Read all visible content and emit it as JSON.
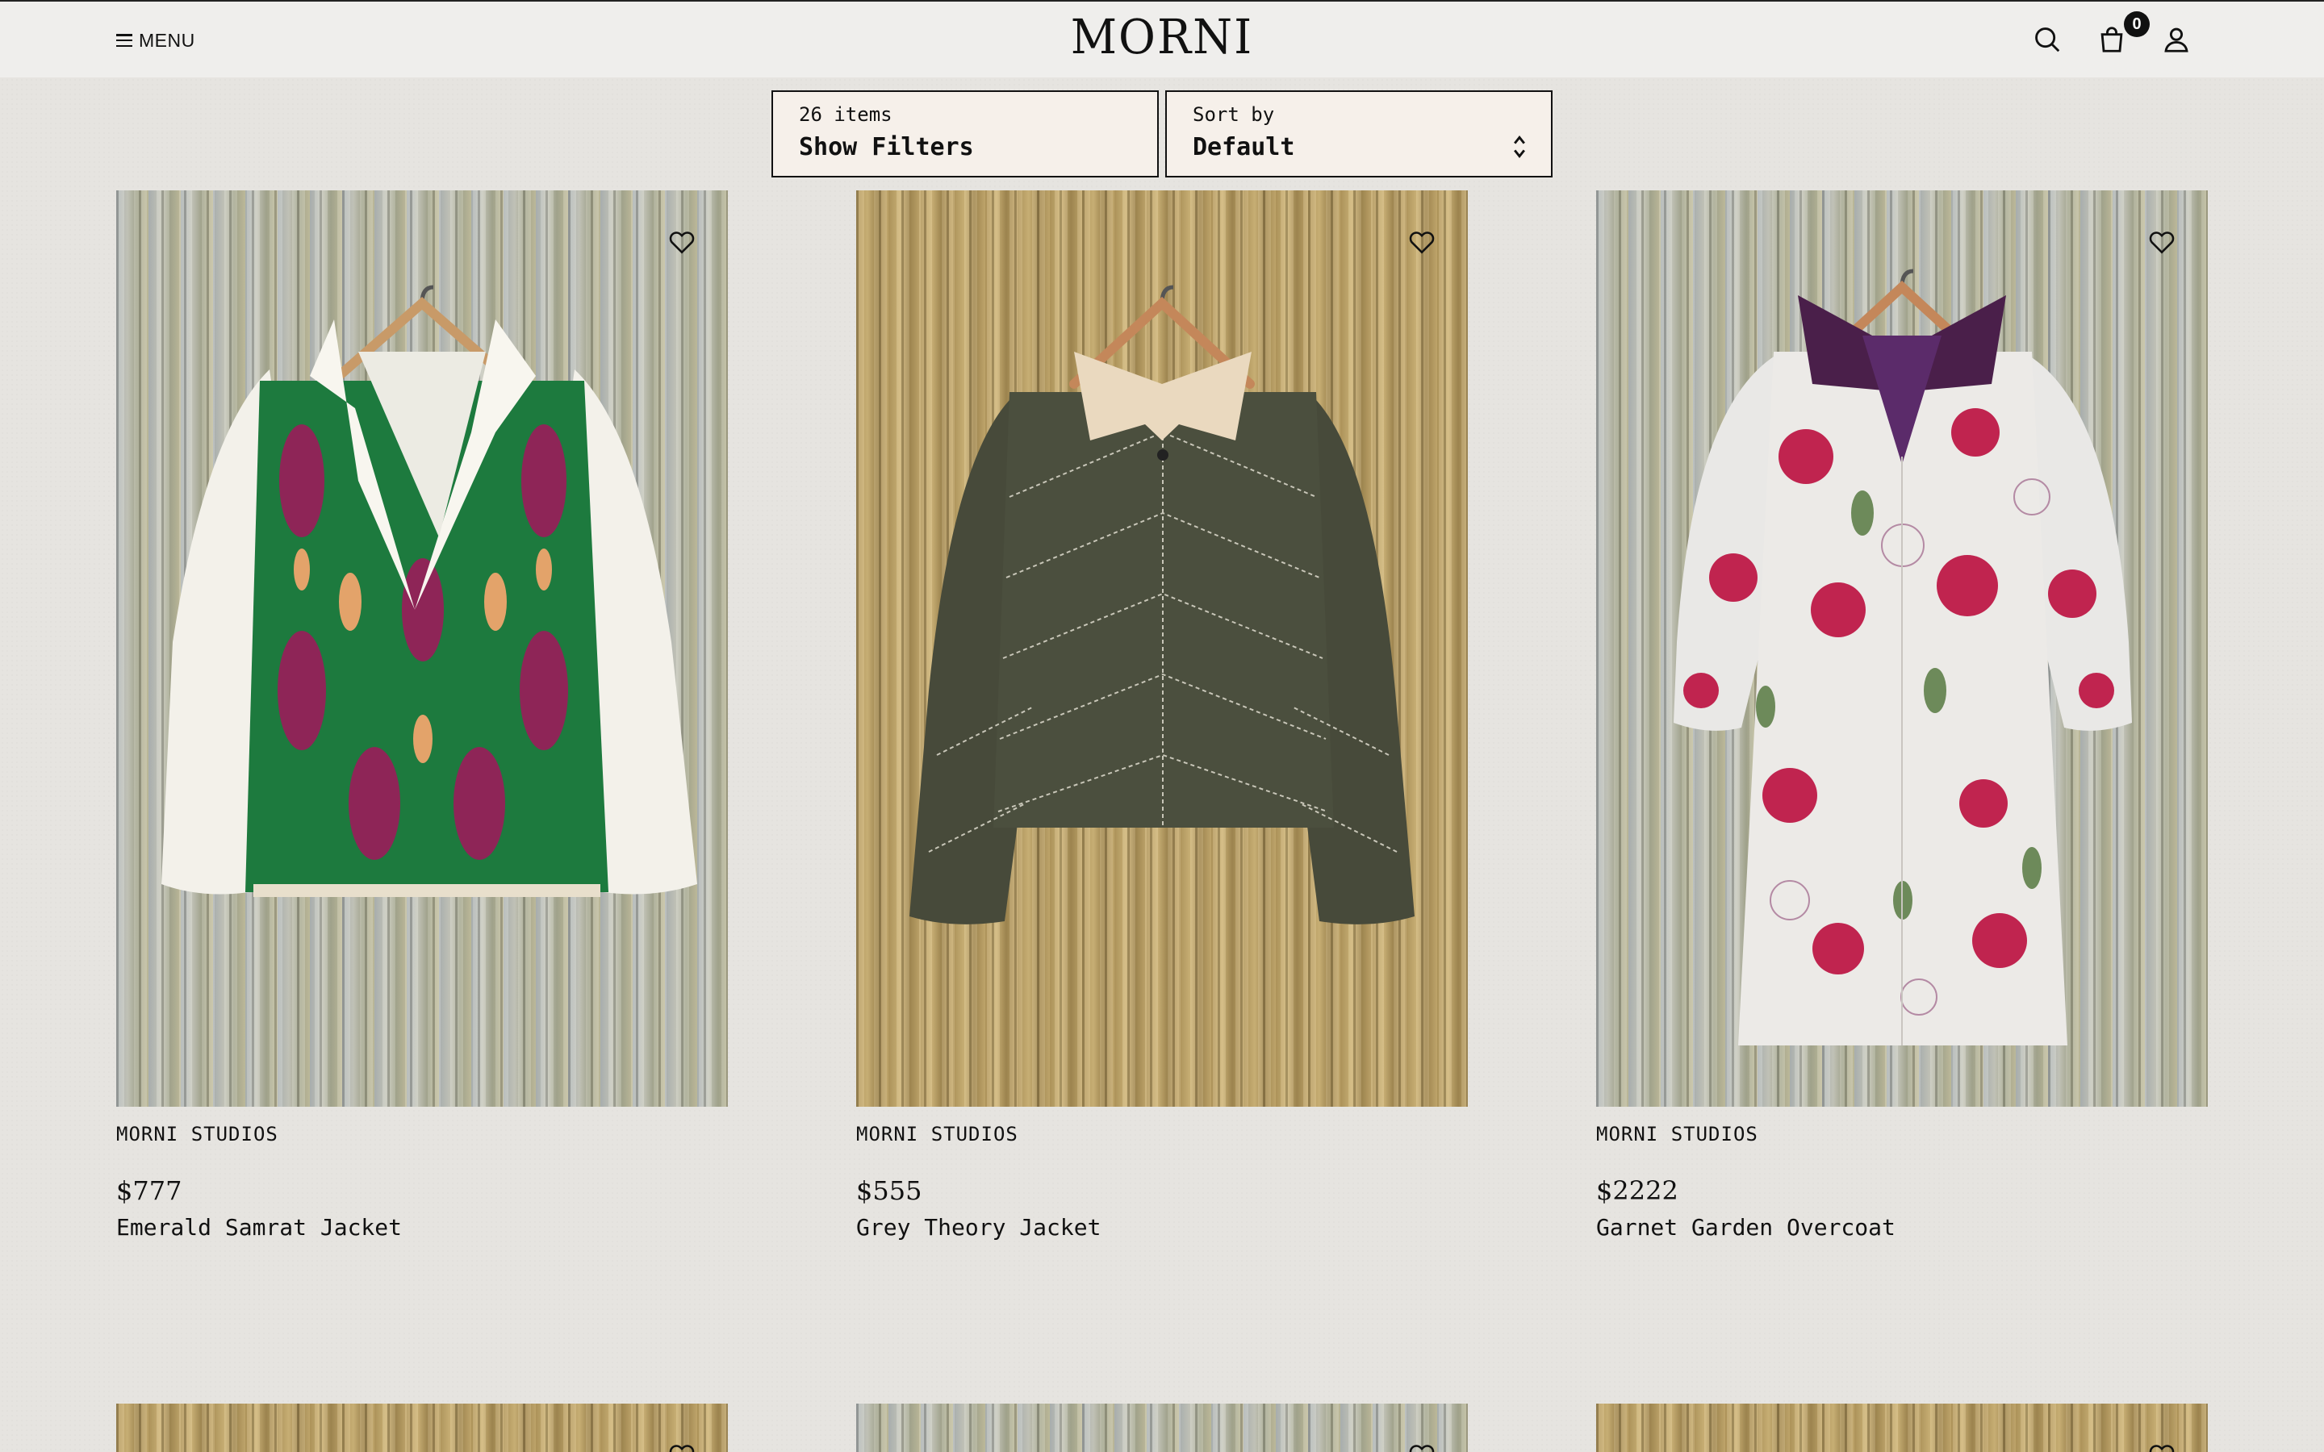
{
  "header": {
    "menu_label": "MENU",
    "logo": "MORNI",
    "cart_count": "0"
  },
  "toolbar": {
    "item_count": "26 items",
    "filter_label": "Show Filters",
    "sort_caption": "Sort by",
    "sort_value": "Default"
  },
  "products": [
    {
      "brand": "MORNI STUDIOS",
      "price": "$777",
      "name": "Emerald Samrat Jacket"
    },
    {
      "brand": "MORNI STUDIOS",
      "price": "$555",
      "name": "Grey Theory Jacket"
    },
    {
      "brand": "MORNI STUDIOS",
      "price": "$2222",
      "name": "Garnet Garden Overcoat"
    }
  ],
  "colors": {
    "page_bg": "#e6e4e0",
    "header_bg": "#efeeec",
    "toolbar_bg": "#f6f0ea",
    "text": "#111111"
  },
  "icons": [
    "menu-icon",
    "search-icon",
    "bag-icon",
    "user-icon",
    "heart-icon",
    "chevron-updown-icon"
  ]
}
